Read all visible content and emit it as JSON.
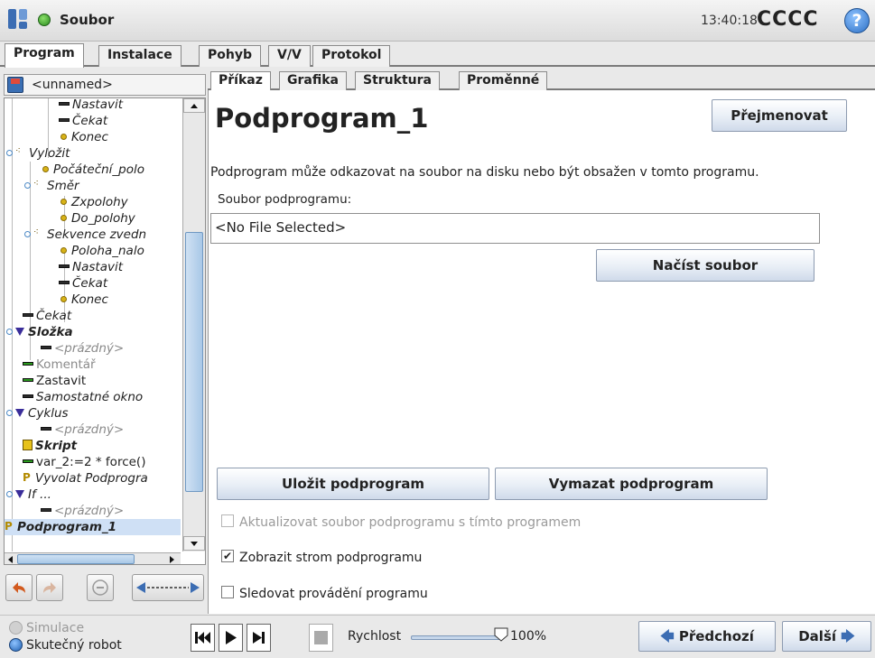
{
  "header": {
    "title": "Soubor",
    "time": "13:40:18",
    "robot_name": "CCCC",
    "help": "?"
  },
  "main_tabs": [
    {
      "label": "Program",
      "active": true
    },
    {
      "label": "Instalace",
      "active": false
    },
    {
      "label": "Pohyb",
      "active": false
    },
    {
      "label": "V/V",
      "active": false
    },
    {
      "label": "Protokol",
      "active": false
    }
  ],
  "program_file": "<unnamed>",
  "tree": [
    {
      "label": "Nastavit",
      "icon": "set-icon"
    },
    {
      "label": "Čekat",
      "icon": "wait-icon"
    },
    {
      "label": "Konec",
      "icon": "waypoint-icon"
    },
    {
      "label": "Vyložit",
      "icon": "move-icon"
    },
    {
      "label": "Počáteční_polo",
      "icon": "waypoint-icon"
    },
    {
      "label": "Směr",
      "icon": "move-icon"
    },
    {
      "label": "Zxpolohy",
      "icon": "waypoint-icon"
    },
    {
      "label": "Do_polohy",
      "icon": "waypoint-icon"
    },
    {
      "label": "Sekvence zvedn",
      "icon": "move-icon"
    },
    {
      "label": "Poloha_nalo",
      "icon": "waypoint-icon"
    },
    {
      "label": "Nastavit",
      "icon": "set-icon"
    },
    {
      "label": "Čekat",
      "icon": "wait-icon"
    },
    {
      "label": "Konec",
      "icon": "waypoint-icon"
    },
    {
      "label": "Čekat",
      "icon": "wait-icon"
    },
    {
      "label": "Složka",
      "icon": "folder-icon"
    },
    {
      "label": "<prázdný>",
      "icon": "empty-icon"
    },
    {
      "label": "Komentář",
      "icon": "comment-icon"
    },
    {
      "label": "Zastavit",
      "icon": "halt-icon"
    },
    {
      "label": "Samostatné okno",
      "icon": "popup-icon"
    },
    {
      "label": "Cyklus",
      "icon": "loop-icon"
    },
    {
      "label": "<prázdný>",
      "icon": "empty-icon"
    },
    {
      "label": "Skript",
      "icon": "script-icon"
    },
    {
      "label": "var_2:=2 * force()",
      "icon": "assignment-icon"
    },
    {
      "label": "Vyvolat Podprogra",
      "icon": "call-icon"
    },
    {
      "label": "If ...",
      "icon": "if-icon"
    },
    {
      "label": "<prázdný>",
      "icon": "empty-icon"
    },
    {
      "label": "Podprogram_1",
      "icon": "subprogram-icon"
    }
  ],
  "sub_tabs": [
    {
      "label": "Příkaz",
      "active": true
    },
    {
      "label": "Grafika",
      "active": false
    },
    {
      "label": "Struktura",
      "active": false
    },
    {
      "label": "Proměnné",
      "active": false
    }
  ],
  "command": {
    "title": "Podprogram_1",
    "rename_button": "Přejmenovat",
    "description": "Podprogram může odkazovat na soubor na disku nebo být obsažen v tomto programu.",
    "file_label": "Soubor podprogramu:",
    "file_value": "<No File Selected>",
    "load_button": "Načíst soubor",
    "save_button": "Uložit podprogram",
    "delete_button": "Vymazat podprogram",
    "checkbox_update": "Aktualizovat soubor podprogramu s tímto programem",
    "checkbox_show_tree": "Zobrazit strom podprogramu",
    "checkbox_track": "Sledovat provádění programu"
  },
  "footer": {
    "simulation": "Simulace",
    "real_robot": "Skutečný robot",
    "speed_label": "Rychlost",
    "speed_value": "100%",
    "speed_fraction": 1.0,
    "prev_button": "Předchozí",
    "next_button": "Další"
  },
  "colors": {
    "accent": "#2c6fc4",
    "status_ok": "#2a8a1e",
    "button_bg": "#e8eef6"
  }
}
